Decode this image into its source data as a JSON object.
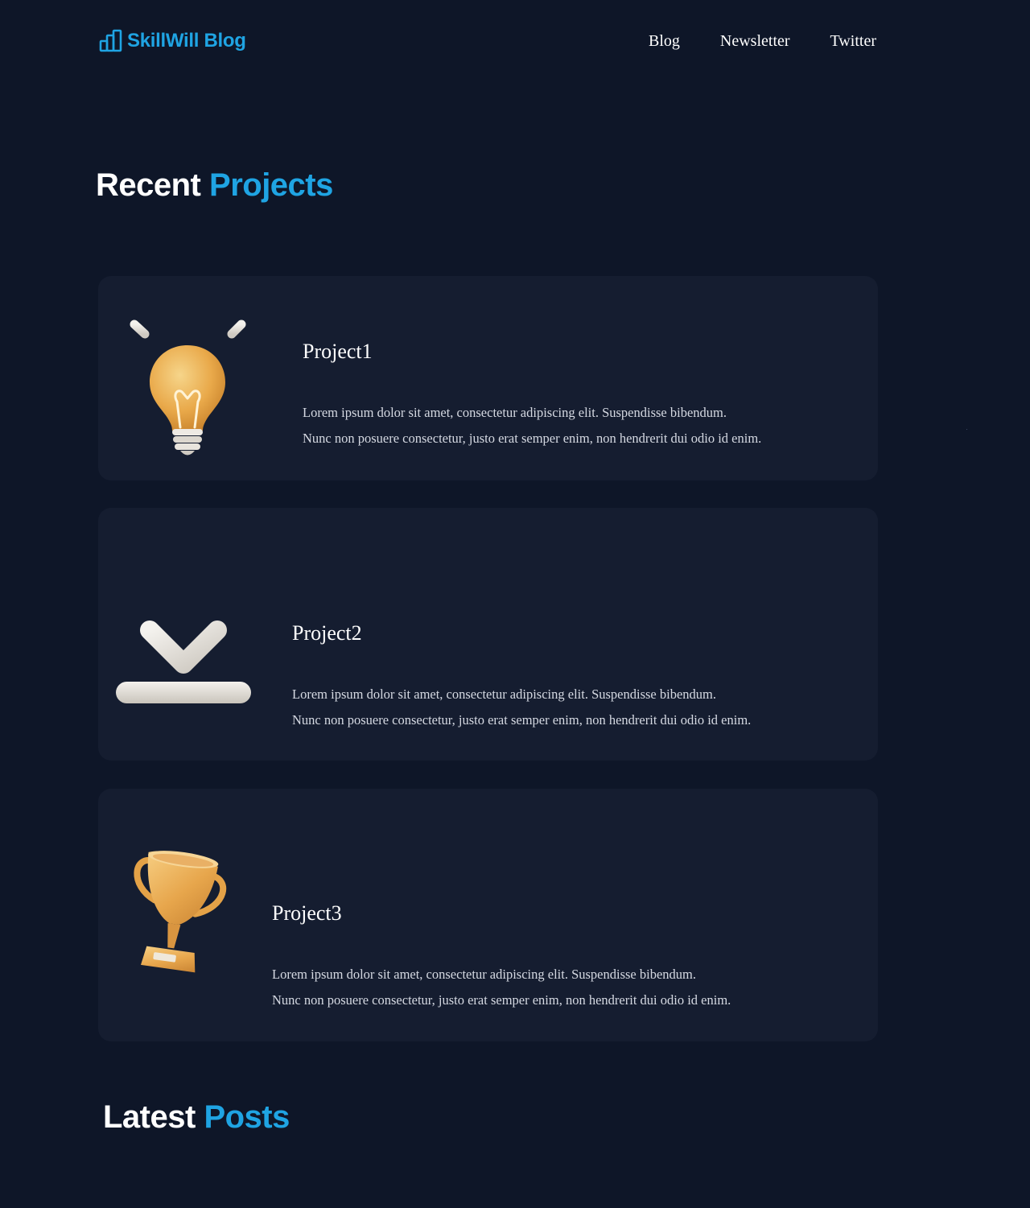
{
  "brand": {
    "name": "SkillWill Blog",
    "icon": "bar-chart-icon",
    "accent_color": "#1fa4e3"
  },
  "nav": {
    "items": [
      {
        "label": "Blog"
      },
      {
        "label": "Newsletter"
      },
      {
        "label": "Twitter"
      }
    ]
  },
  "projects_section": {
    "title_main": "Recent",
    "title_accent": "Projects"
  },
  "projects": [
    {
      "title": "Project1",
      "icon": "lightbulb-icon",
      "description_line1": "Lorem ipsum dolor sit amet, consectetur adipiscing elit. Suspendisse bibendum.",
      "description_line2": "Nunc non posuere consectetur, justo erat semper enim, non hendrerit dui odio id enim."
    },
    {
      "title": "Project2",
      "icon": "download-arrow-icon",
      "description_line1": "Lorem ipsum dolor sit amet, consectetur adipiscing elit. Suspendisse bibendum.",
      "description_line2": "Nunc non posuere consectetur, justo erat semper enim, non hendrerit dui odio id enim."
    },
    {
      "title": "Project3",
      "icon": "trophy-icon",
      "description_line1": "Lorem ipsum dolor sit amet, consectetur adipiscing elit. Suspendisse bibendum.",
      "description_line2": "Nunc non posuere consectetur, justo erat semper enim, non hendrerit dui odio id enim."
    }
  ],
  "posts_section": {
    "title_main": "Latest",
    "title_accent": "Posts"
  },
  "colors": {
    "background": "#0e1628",
    "card_background": "#151d30",
    "accent": "#1fa4e3"
  }
}
